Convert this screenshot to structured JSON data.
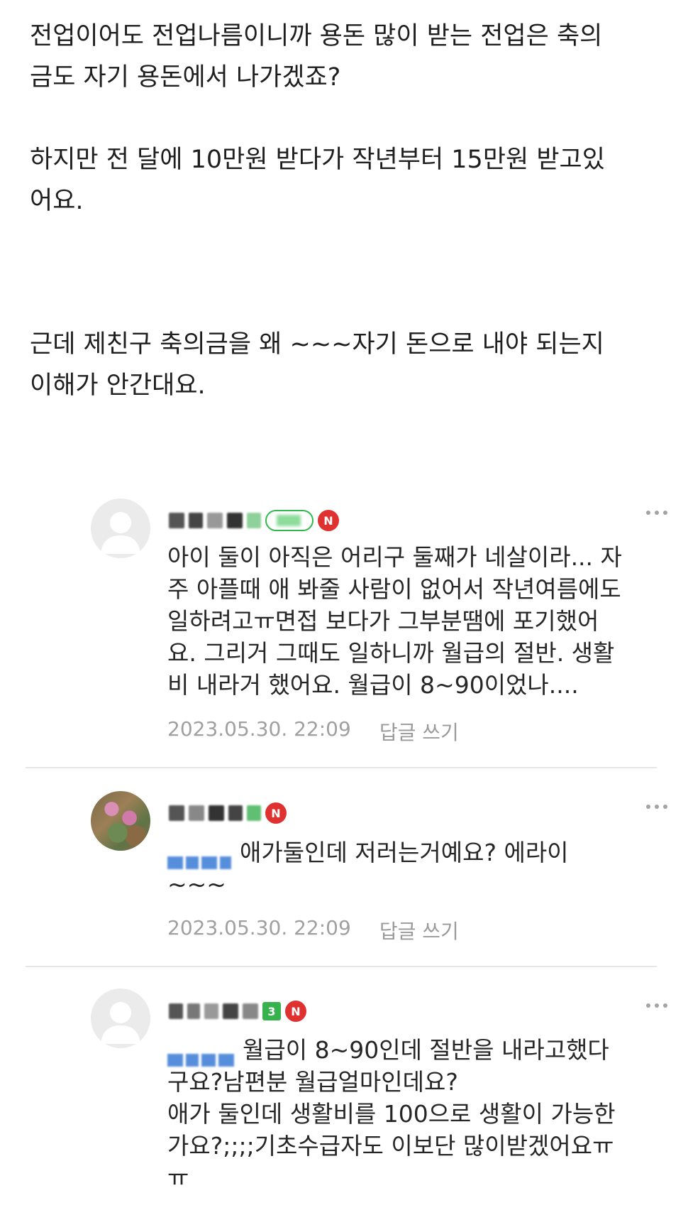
{
  "post": {
    "paragraphs": [
      [
        "전업이어도 전업나름이니까 용돈 많이 받는 전업은 축의",
        "금도 자기 용돈에서 나가겠죠?"
      ],
      [
        "하지만 전 달에 10만원 받다가 작년부터 15만원 받고있",
        "어요."
      ],
      [
        "근데 제친구 축의금을 왜 ~~~자기 돈으로 내야 되는지",
        "이해가 안간대요."
      ]
    ]
  },
  "comments": [
    {
      "new_badge": "N",
      "lines": [
        "아이 둘이 아직은 어리구 둘째가 네살이라... 자",
        "주 아플때 애 봐줄 사람이 없어서 작년여름에도",
        "일하려고ㅠ면접 보다가 그부분땜에 포기했어",
        "요. 그리거 그때도 일하니까 월급의 절반. 생활",
        "비 내라거 했어요. 월급이 8~90이었나...."
      ],
      "timestamp": "2023.05.30. 22:09",
      "reply_label": "답글 쓰기"
    },
    {
      "new_badge": "N",
      "lines": [
        "애가둘인데 저러는거예요? 에라이",
        "~~~"
      ],
      "timestamp": "2023.05.30. 22:09",
      "reply_label": "답글 쓰기"
    },
    {
      "level": "3",
      "new_badge": "N",
      "lines": [
        "월급이 8~90인데 절반을 내라고했다",
        "구요?남편분 월급얼마인데요?",
        "애가 둘인데 생활비를 100으로 생활이 가능한",
        "가요?;;;;기초수급자도 이보단 많이받겠어요ㅠ",
        "ㅠ"
      ]
    }
  ],
  "colors": {
    "level_green": "#2fba4a",
    "new_red": "#e03131",
    "mention_blue": "#3a7bd5",
    "meta_gray": "#a0a0a0"
  },
  "icons": [
    "default-avatar-icon",
    "more-options-icon",
    "new-badge-icon"
  ]
}
